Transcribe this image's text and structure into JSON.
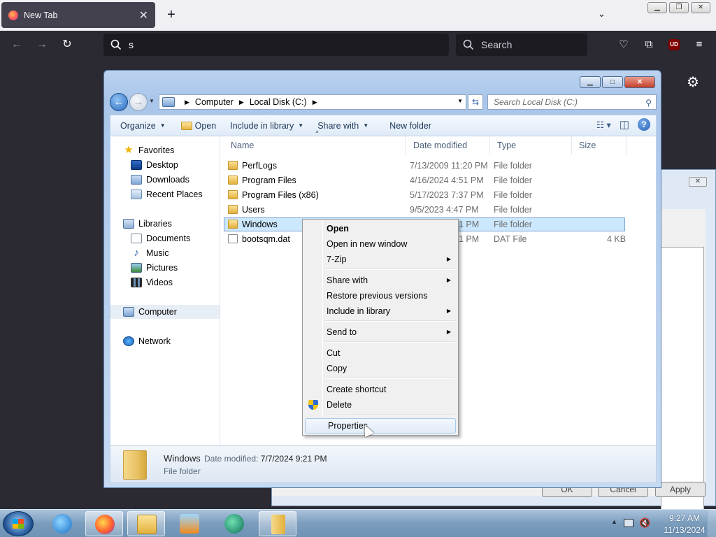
{
  "firefox": {
    "tab_title": "New Tab",
    "tab_close": "✕",
    "new_tab": "+",
    "url_value": "s",
    "search_placeholder": "Search",
    "addon_badge": "UD"
  },
  "bg_dialog": {
    "close": "✕",
    "ok": "OK",
    "cancel": "Cancel",
    "apply": "Apply"
  },
  "explorer": {
    "breadcrumb": [
      "Computer",
      "Local Disk (C:)"
    ],
    "search_placeholder": "Search Local Disk (C:)",
    "toolbar": {
      "organize": "Organize",
      "open": "Open",
      "include_in_library": "Include in library",
      "share_with": "Share with",
      "new_folder": "New folder"
    },
    "nav": {
      "favorites": "Favorites",
      "desktop": "Desktop",
      "downloads": "Downloads",
      "recent_places": "Recent Places",
      "libraries": "Libraries",
      "documents": "Documents",
      "music": "Music",
      "pictures": "Pictures",
      "videos": "Videos",
      "computer": "Computer",
      "network": "Network"
    },
    "columns": {
      "name": "Name",
      "date": "Date modified",
      "type": "Type",
      "size": "Size"
    },
    "files": [
      {
        "name": "PerfLogs",
        "date": "7/13/2009 11:20 PM",
        "type": "File folder",
        "size": ""
      },
      {
        "name": "Program Files",
        "date": "4/16/2024 4:51 PM",
        "type": "File folder",
        "size": ""
      },
      {
        "name": "Program Files (x86)",
        "date": "5/17/2023 7:37 PM",
        "type": "File folder",
        "size": ""
      },
      {
        "name": "Users",
        "date": "9/5/2023 4:47 PM",
        "type": "File folder",
        "size": ""
      },
      {
        "name": "Windows",
        "date": "1 PM",
        "type": "File folder",
        "size": ""
      },
      {
        "name": "bootsqm.dat",
        "date": "1 PM",
        "type": "DAT File",
        "size": "4 KB"
      }
    ],
    "details": {
      "name": "Windows",
      "modified_label": "Date modified:",
      "modified_value": "7/7/2024 9:21 PM",
      "type": "File folder"
    }
  },
  "context_menu": {
    "open": "Open",
    "open_new_window": "Open in new window",
    "seven_zip": "7-Zip",
    "share_with": "Share with",
    "restore_previous": "Restore previous versions",
    "include_in_library": "Include in library",
    "send_to": "Send to",
    "cut": "Cut",
    "copy": "Copy",
    "create_shortcut": "Create shortcut",
    "delete": "Delete",
    "properties": "Properties"
  },
  "taskbar": {
    "time": "9:27 AM",
    "date": "11/13/2024"
  }
}
